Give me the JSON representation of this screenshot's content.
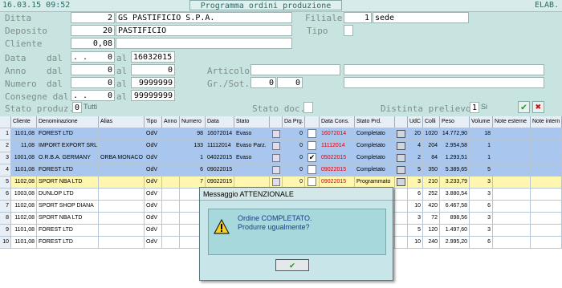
{
  "header": {
    "datetime": "16.03.15 09:52",
    "title": "Programma ordini produzione",
    "status": "ELAB."
  },
  "form": {
    "ditta": {
      "label": "Ditta",
      "code": "2",
      "name": "GS PASTIFICIO S.P.A."
    },
    "filiale": {
      "label": "Filiale",
      "code": "1",
      "name": "sede"
    },
    "deposito": {
      "label": "Deposito",
      "code": "20",
      "name": "PASTIFICIO"
    },
    "tipo": {
      "label": "Tipo",
      "value": ""
    },
    "cliente": {
      "label": "Cliente",
      "code": "0,08",
      "name": ""
    },
    "dal_label": "dal",
    "al_label": "al",
    "data": {
      "label": "Data",
      "dal": ". .",
      "dal_val": "0",
      "al": "16032015"
    },
    "anno": {
      "label": "Anno",
      "dal": "0",
      "al": "0"
    },
    "articolo": {
      "label": "Articolo",
      "value": ""
    },
    "numero": {
      "label": "Numero",
      "dal": "0",
      "al": "9999999"
    },
    "grsot": {
      "label": "Gr./Sot.",
      "v1": "0",
      "v2": "0"
    },
    "consegne": {
      "label": "Consegne dal",
      "dal": ". .",
      "dal_val": "0",
      "al": "99999999"
    },
    "stato_produz": {
      "label": "Stato produz.",
      "value": "0",
      "text": "Tutti"
    },
    "stato_doc": {
      "label": "Stato doc.",
      "value": ""
    },
    "distinta": {
      "label": "Distinta prelievo",
      "value": "1",
      "text": "Si"
    }
  },
  "grid": {
    "columns": [
      "Cliente",
      "Denominazione",
      "Alias",
      "Tipo",
      "Anno",
      "Numero",
      "Data",
      "Stato",
      "",
      "Da Prg.",
      "",
      "Data Cons.",
      "Stato Prd.",
      "",
      "UdC",
      "Colli",
      "Peso",
      "Volume",
      "Note esterne",
      "Note intern"
    ],
    "rows": [
      {
        "n": "1",
        "cliente": "1101,08",
        "denom": "FOREST LTD",
        "alias": "",
        "tipo": "OdV",
        "anno": "",
        "numero": "98",
        "data": "16072014",
        "stato": "Evaso",
        "daprg": "0",
        "check": false,
        "datacons": "16072014",
        "statoprd": "Completato",
        "udc": "20",
        "colli": "1020",
        "peso": "14.772,90",
        "volume": "18",
        "style": "blue"
      },
      {
        "n": "2",
        "cliente": "11,08",
        "denom": "IMPORT EXPORT SRL",
        "alias": "",
        "tipo": "OdV",
        "anno": "",
        "numero": "133",
        "data": "11112014",
        "stato": "Evaso Parz.",
        "daprg": "0",
        "check": false,
        "datacons": "11112014",
        "statoprd": "Completato",
        "udc": "4",
        "colli": "204",
        "peso": "2.954,58",
        "volume": "1",
        "style": "blue"
      },
      {
        "n": "3",
        "cliente": "1001,08",
        "denom": "O.R.B.A. GERMANY",
        "alias": "ORBA MONACO",
        "tipo": "OdV",
        "anno": "",
        "numero": "1",
        "data": "04022015",
        "stato": "Evaso",
        "daprg": "0",
        "check": true,
        "datacons": "05022015",
        "statoprd": "Completato",
        "udc": "2",
        "colli": "84",
        "peso": "1.293,51",
        "volume": "1",
        "style": "blue"
      },
      {
        "n": "4",
        "cliente": "1101,08",
        "denom": "FOREST LTD",
        "alias": "",
        "tipo": "OdV",
        "anno": "",
        "numero": "6",
        "data": "09022015",
        "stato": "",
        "daprg": "0",
        "check": false,
        "datacons": "09022015",
        "statoprd": "Completato",
        "udc": "5",
        "colli": "350",
        "peso": "5.389,65",
        "volume": "5",
        "style": "blue"
      },
      {
        "n": "5",
        "cliente": "1102,08",
        "denom": "SPORT NBA LTD",
        "alias": "",
        "tipo": "OdV",
        "anno": "",
        "numero": "7",
        "data": "09022015",
        "stato": "",
        "daprg": "0",
        "check": false,
        "datacons": "09022015",
        "statoprd": "Programmato",
        "udc": "3",
        "colli": "210",
        "peso": "3.233,79",
        "volume": "3",
        "style": "yellow"
      },
      {
        "n": "6",
        "cliente": "1003,08",
        "denom": "DUNLOP LTD",
        "alias": "",
        "tipo": "OdV",
        "anno": "",
        "numero": "",
        "data": "",
        "stato": "",
        "daprg": "",
        "check": false,
        "datacons": "",
        "statoprd": "",
        "udc": "6",
        "colli": "252",
        "peso": "3.880,54",
        "volume": "3",
        "style": "white"
      },
      {
        "n": "7",
        "cliente": "1102,08",
        "denom": "SPORT SHOP DIANA",
        "alias": "",
        "tipo": "OdV",
        "anno": "",
        "numero": "",
        "data": "",
        "stato": "",
        "daprg": "",
        "check": false,
        "datacons": "",
        "statoprd": "",
        "udc": "10",
        "colli": "420",
        "peso": "6.467,58",
        "volume": "6",
        "style": "white"
      },
      {
        "n": "8",
        "cliente": "1102,08",
        "denom": "SPORT NBA LTD",
        "alias": "",
        "tipo": "OdV",
        "anno": "",
        "numero": "",
        "data": "",
        "stato": "",
        "daprg": "",
        "check": false,
        "datacons": "",
        "statoprd": "",
        "udc": "3",
        "colli": "72",
        "peso": "898,56",
        "volume": "3",
        "style": "white"
      },
      {
        "n": "9",
        "cliente": "1101,08",
        "denom": "FOREST LTD",
        "alias": "",
        "tipo": "OdV",
        "anno": "",
        "numero": "",
        "data": "",
        "stato": "",
        "daprg": "",
        "check": false,
        "datacons": "",
        "statoprd": "",
        "udc": "5",
        "colli": "120",
        "peso": "1.497,60",
        "volume": "3",
        "style": "white"
      },
      {
        "n": "10",
        "cliente": "1101,08",
        "denom": "FOREST LTD",
        "alias": "",
        "tipo": "OdV",
        "anno": "",
        "numero": "",
        "data": "",
        "stato": "",
        "daprg": "",
        "check": false,
        "datacons": "",
        "statoprd": "",
        "udc": "10",
        "colli": "240",
        "peso": "2.995,20",
        "volume": "6",
        "style": "white"
      }
    ]
  },
  "dialog": {
    "title": "Messaggio ATTENZIONALE",
    "message": "Ordine COMPLETATO. Produrre ugualmente?",
    "ok_symbol": "✔"
  },
  "colors": {
    "blue_row": "#a9c7ee",
    "yellow_row": "#fff6b0",
    "red_text": "#e00000"
  }
}
